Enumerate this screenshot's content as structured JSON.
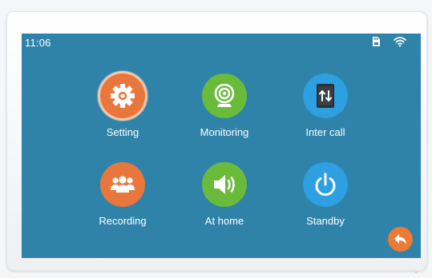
{
  "status_bar": {
    "time": "11:06",
    "icons": [
      "sd-card-icon",
      "wifi-icon"
    ]
  },
  "menu": {
    "items": [
      {
        "label": "Setting",
        "icon": "gear-icon",
        "color": "#e9773d"
      },
      {
        "label": "Monitoring",
        "icon": "camera-icon",
        "color": "#6bbb3b"
      },
      {
        "label": "Inter call",
        "icon": "intercom-icon",
        "color": "#2e9fe0"
      },
      {
        "label": "Recording",
        "icon": "people-icon",
        "color": "#e9773d"
      },
      {
        "label": "At home",
        "icon": "speaker-icon",
        "color": "#6bbb3b"
      },
      {
        "label": "Standby",
        "icon": "power-icon",
        "color": "#2e9fe0"
      }
    ],
    "selected": "Setting"
  },
  "back_button": {
    "icon": "back-arrow-icon",
    "color": "#ea7a34"
  },
  "colors": {
    "screen_background": "#2f83a9",
    "text": "#ffffff"
  }
}
